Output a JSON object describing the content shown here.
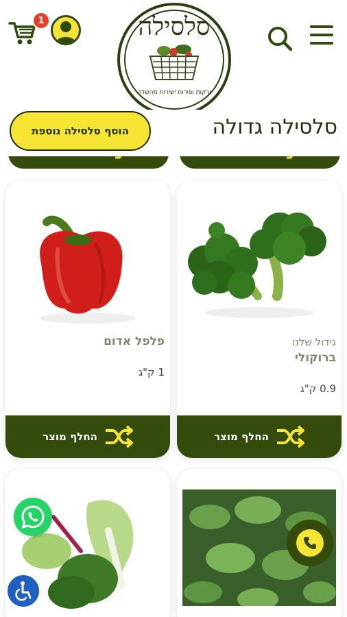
{
  "header": {
    "cart_icon": "cart-icon",
    "cart_count": "1",
    "avatar_icon": "user-icon",
    "logo_title": "סלסילה",
    "logo_subtitle": "ירקות ופירות ישירות מהשדה",
    "search_icon": "search-icon",
    "menu_icon": "hamburger-menu-icon"
  },
  "page": {
    "title": "סלסילה גדולה",
    "add_basket_label": "הוסף סלסילה נוספת"
  },
  "products": [
    {
      "image": "broccoli",
      "tag": "גידול שלנו",
      "name": "ברוקולי",
      "quantity": "0.9 ק\"ג",
      "swap_label": "החלף מוצר"
    },
    {
      "image": "red-pepper",
      "tag": "",
      "name": "פלפל אדום",
      "quantity": "1 ק\"ג",
      "swap_label": "החלף מוצר"
    },
    {
      "image": "leafy-greens",
      "tag": "",
      "name": "",
      "quantity": "",
      "swap_label": ""
    },
    {
      "image": "chard",
      "tag": "",
      "name": "",
      "quantity": "",
      "swap_label": ""
    }
  ],
  "floating": {
    "whatsapp_icon": "whatsapp-icon",
    "accessibility_icon": "accessibility-icon",
    "phone_icon": "phone-icon"
  },
  "colors": {
    "brand_dark_green": "#354b0b",
    "brand_yellow": "#f6e435",
    "badge_red": "#e0402c",
    "product_name_green": "#7c8a6a"
  }
}
